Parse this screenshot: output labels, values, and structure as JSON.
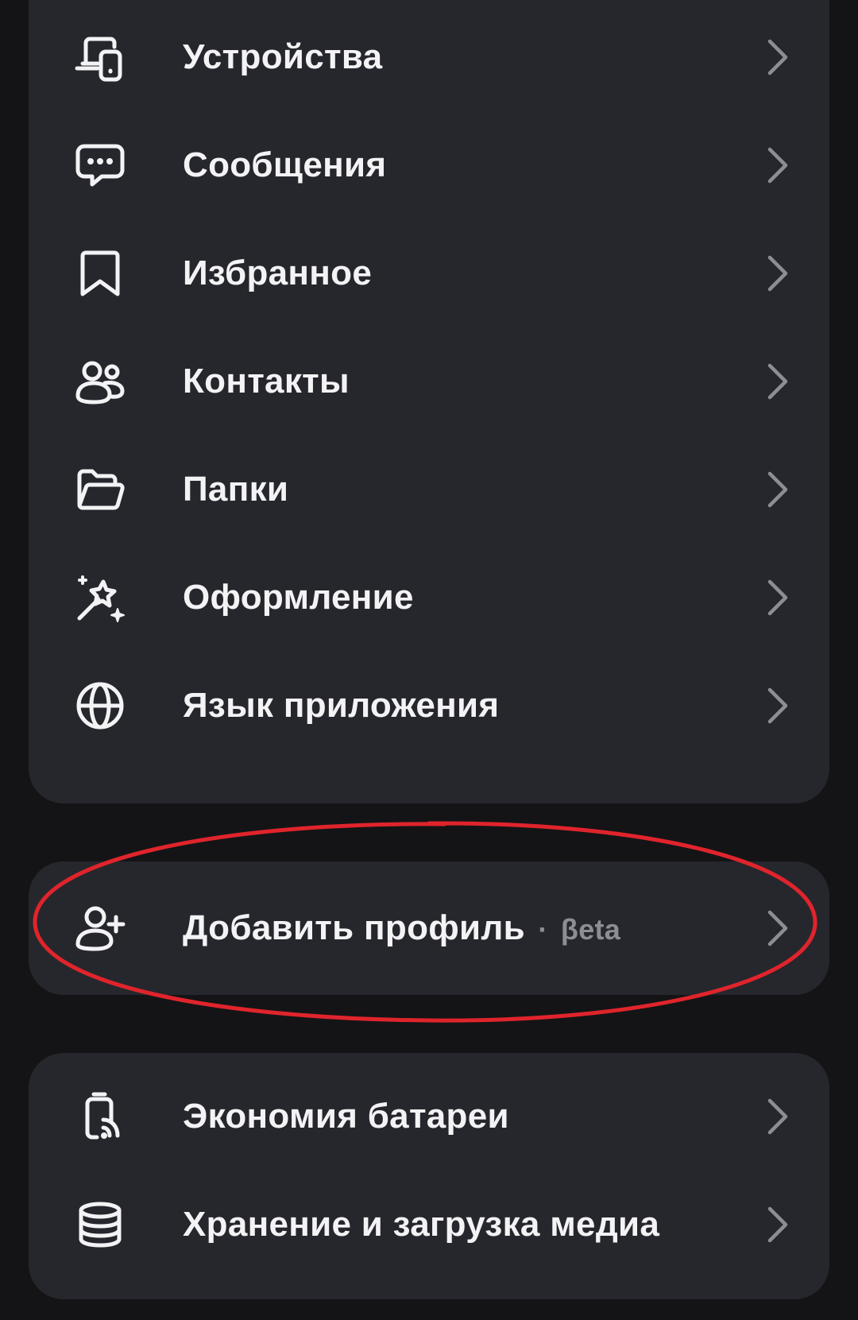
{
  "colors": {
    "background": "#141416",
    "card": "#26272c",
    "text": "#f3f3f5",
    "secondary_text": "#8d8e93",
    "chevron": "#8d8e93",
    "annotation": "#e0242c"
  },
  "menu_main": [
    {
      "label": "Устройства",
      "icon": "devices-icon"
    },
    {
      "label": "Сообщения",
      "icon": "chat-bubble-icon"
    },
    {
      "label": "Избранное",
      "icon": "bookmark-icon"
    },
    {
      "label": "Контакты",
      "icon": "contacts-icon"
    },
    {
      "label": "Папки",
      "icon": "folder-icon"
    },
    {
      "label": "Оформление",
      "icon": "magic-wand-icon"
    },
    {
      "label": "Язык приложения",
      "icon": "globe-icon"
    }
  ],
  "menu_profile": {
    "label": "Добавить профиль",
    "separator": " · ",
    "badge": "βeta",
    "icon": "add-user-icon"
  },
  "menu_storage": [
    {
      "label": "Экономия батареи",
      "icon": "battery-saver-icon"
    },
    {
      "label": "Хранение и загрузка медиа",
      "icon": "database-icon"
    }
  ]
}
